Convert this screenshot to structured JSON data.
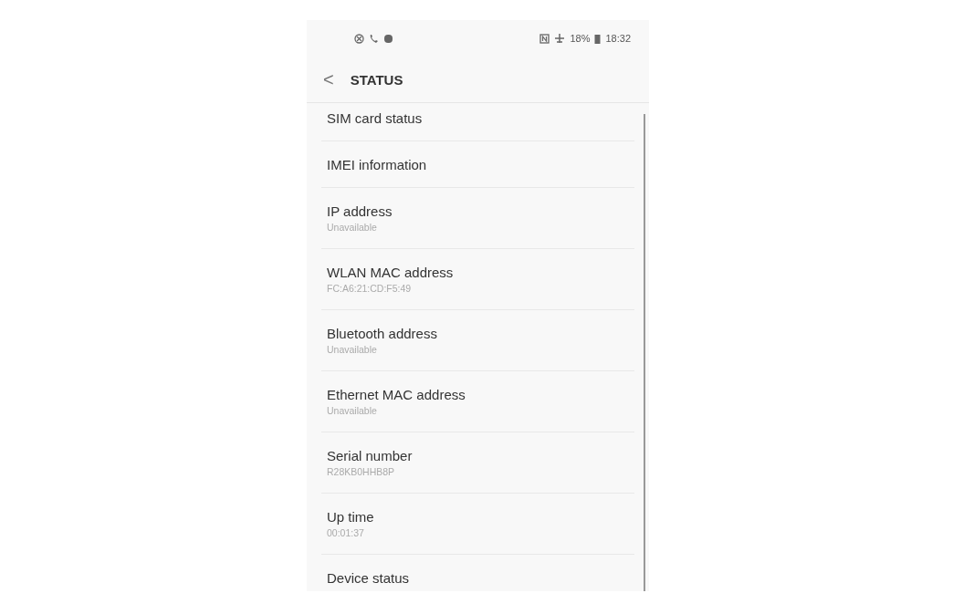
{
  "status_bar": {
    "battery": "18%",
    "time": "18:32"
  },
  "header": {
    "back": "<",
    "title": "STATUS"
  },
  "items": [
    {
      "title": "SIM card status"
    },
    {
      "title": "IMEI information"
    },
    {
      "title": "IP address",
      "value": "Unavailable"
    },
    {
      "title": "WLAN MAC address",
      "value": "FC:A6:21:CD:F5:49"
    },
    {
      "title": "Bluetooth address",
      "value": "Unavailable"
    },
    {
      "title": "Ethernet MAC address",
      "value": "Unavailable"
    },
    {
      "title": "Serial number",
      "value": "R28KB0HHB8P"
    },
    {
      "title": "Up time",
      "value": "00:01:37"
    },
    {
      "title": "Device status"
    }
  ]
}
